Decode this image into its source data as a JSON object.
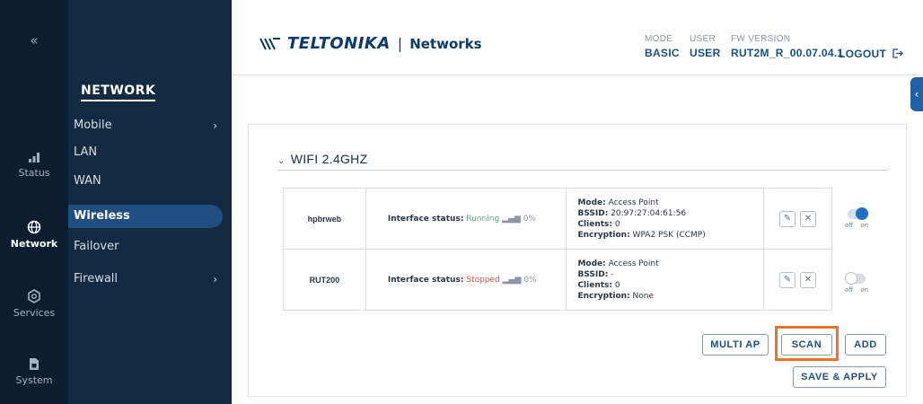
{
  "rail": {
    "collapse_glyph": "«",
    "items": [
      {
        "label": "Status",
        "icon": "signal-bars-icon"
      },
      {
        "label": "Network",
        "icon": "globe-icon"
      },
      {
        "label": "Services",
        "icon": "gear-icon"
      },
      {
        "label": "System",
        "icon": "sim-card-icon"
      }
    ],
    "active": "Network"
  },
  "menu": {
    "title": "NETWORK",
    "items": [
      {
        "label": "Mobile",
        "has_submenu": true
      },
      {
        "label": "LAN",
        "has_submenu": false
      },
      {
        "label": "WAN",
        "has_submenu": false
      },
      {
        "label": "Wireless",
        "has_submenu": false
      },
      {
        "label": "Failover",
        "has_submenu": false
      },
      {
        "label": "Firewall",
        "has_submenu": true
      }
    ],
    "active": "Wireless",
    "chevron": "›"
  },
  "header": {
    "brand": "TELTONIKA",
    "separator": "|",
    "product": "Networks",
    "mode_label": "MODE",
    "mode_value": "BASIC",
    "user_label": "USER",
    "user_value": "USER",
    "fw_label": "FW VERSION",
    "fw_value": "RUT2M_R_00.07.04.1",
    "logout_label": "LOGOUT",
    "logout_icon": "logout-icon",
    "side_tab_glyph": "‹"
  },
  "section": {
    "title": "WIFI 2.4GHZ",
    "chevron": "⌄"
  },
  "networks": [
    {
      "ssid": "hpbrweb",
      "status_label": "Interface status:",
      "status_value": "Running",
      "signal": "0%",
      "mode_label": "Mode:",
      "mode_value": "Access Point",
      "bssid_label": "BSSID:",
      "bssid_value": "20:97:27:04:61:56",
      "clients_label": "Clients:",
      "clients_value": "0",
      "enc_label": "Encryption:",
      "enc_value": "WPA2 PSK (CCMP)",
      "enabled": true
    },
    {
      "ssid": "RUT200",
      "status_label": "Interface status:",
      "status_value": "Stopped",
      "signal": "0%",
      "mode_label": "Mode:",
      "mode_value": "Access Point",
      "bssid_label": "BSSID:",
      "bssid_value": "-",
      "clients_label": "Clients:",
      "clients_value": "0",
      "enc_label": "Encryption:",
      "enc_value": "None",
      "enabled": false
    }
  ],
  "toggle_labels": {
    "off": "off",
    "on": "on"
  },
  "row_actions": {
    "edit_glyph": "✎",
    "delete_glyph": "✕"
  },
  "buttons": {
    "multi_ap": "MULTI AP",
    "scan": "SCAN",
    "add": "ADD",
    "save_apply": "SAVE & APPLY"
  },
  "colors": {
    "rail_bg": "#0b1d2f",
    "menu_bg": "#132a40",
    "active_item": "#1f4f80",
    "accent": "#1b4f86",
    "running": "#4caf7a",
    "stopped": "#d9534f",
    "highlight": "#e8752a"
  }
}
